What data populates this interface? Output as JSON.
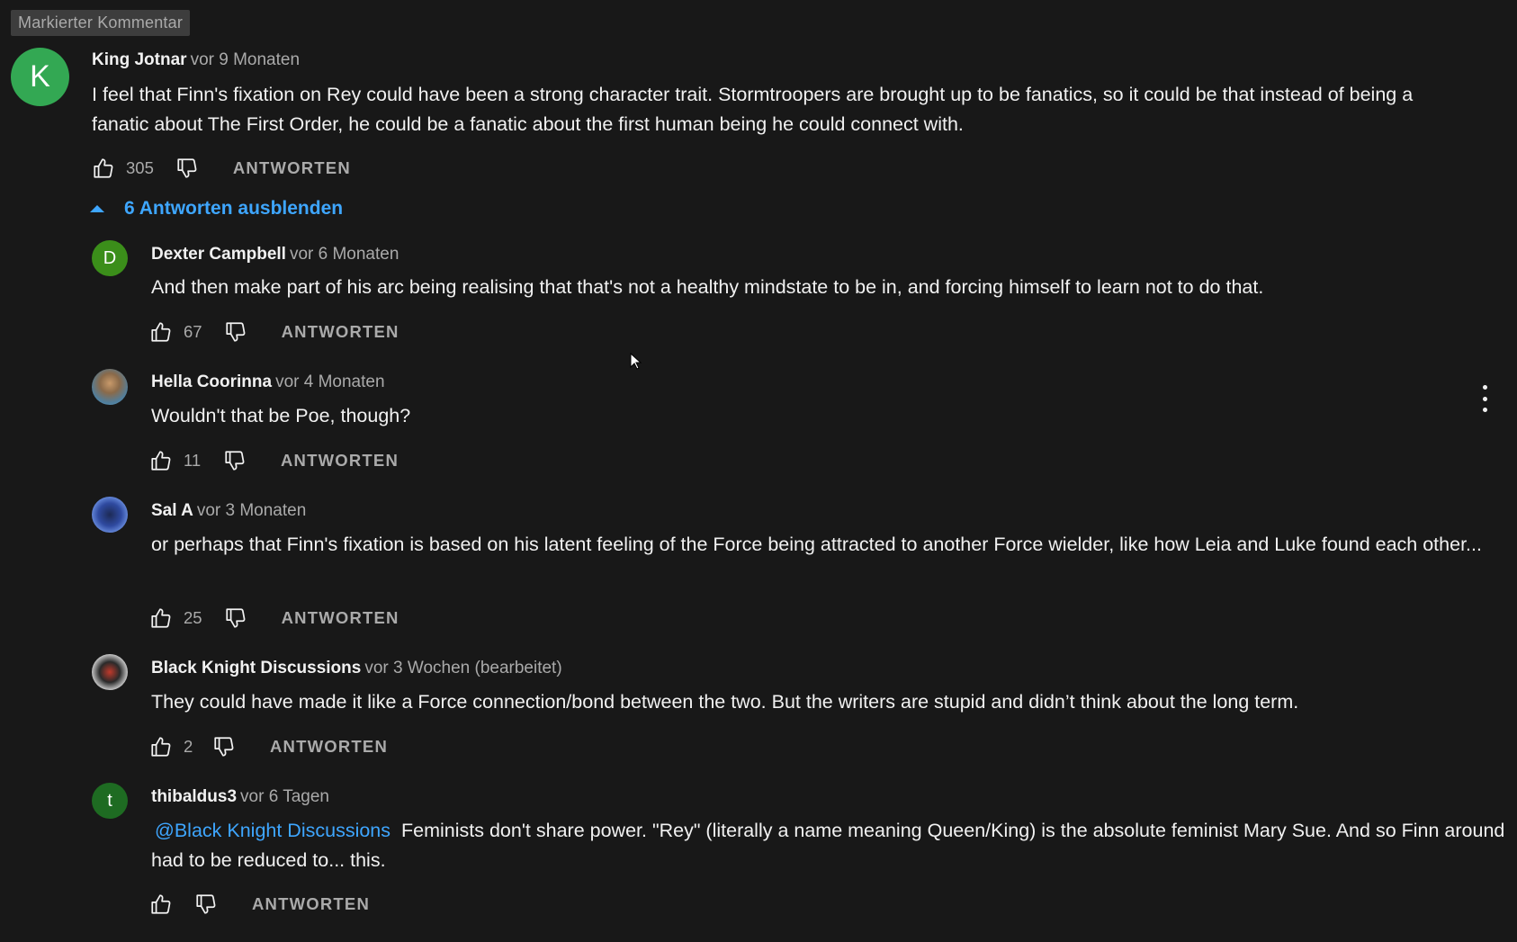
{
  "highlight_label": "Markierter Kommentar",
  "main_comment": {
    "avatar_letter": "K",
    "avatar_color": "#33a853",
    "author": "King Jotnar",
    "time": "vor 9 Monaten",
    "text": "I feel that Finn's fixation on Rey could have been a strong character trait. Stormtroopers are brought up to be fanatics, so it could be that instead of being a fanatic about The First Order, he could be a fanatic about the first human being he could connect with.",
    "likes": "305",
    "reply_label": "ANTWORTEN"
  },
  "toggle_replies_label": "6 Antworten ausblenden",
  "replies": [
    {
      "avatar_letter": "D",
      "avatar_color": "#3b8e1a",
      "author": "Dexter Campbell",
      "time": "vor 6 Monaten",
      "text": "And then make part of his arc being realising that that's not a healthy mindstate to be in, and forcing himself to learn not to do that.",
      "likes": "67",
      "reply_label": "ANTWORTEN"
    },
    {
      "avatar_letter": "",
      "avatar_color": "#6f8a9a",
      "author": "Hella Coorinna",
      "time": "vor 4 Monaten",
      "text": "Wouldn't that be Poe, though?",
      "likes": "11",
      "reply_label": "ANTWORTEN"
    },
    {
      "avatar_letter": "",
      "avatar_color": "#3c5fb8",
      "author": "Sal A",
      "time": "vor 3 Monaten",
      "text": "or perhaps that Finn's fixation is based on his latent feeling of the Force being attracted to another Force wielder, like how Leia and Luke found each other...",
      "likes": "25",
      "reply_label": "ANTWORTEN"
    },
    {
      "avatar_letter": "",
      "avatar_color": "#5a2a2a",
      "author": "Black Knight Discussions",
      "time": "vor 3 Wochen (bearbeitet)",
      "text": "They could have made it like a Force connection/bond between the two. But the writers are stupid and didn’t think about the long term.",
      "likes": "2",
      "reply_label": "ANTWORTEN"
    },
    {
      "avatar_letter": "t",
      "avatar_color": "#1e6b22",
      "author": "thibaldus3",
      "time": "vor 6 Tagen",
      "mention": "@Black Knight Discussions",
      "text": "Feminists don't share power. \"Rey\" (literally a name meaning Queen/King) is the absolute feminist Mary Sue. And so Finn around had to be reduced to... this.",
      "likes": "",
      "reply_label": "ANTWORTEN"
    }
  ],
  "icons": {
    "like": "thumbs-up-icon",
    "dislike": "thumbs-down-icon",
    "toggle": "chevron-up-icon",
    "menu": "more-vert-icon"
  }
}
